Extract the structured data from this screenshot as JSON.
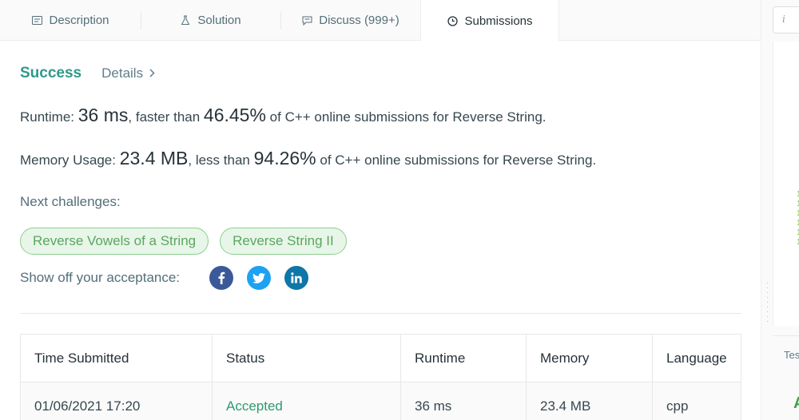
{
  "tabs": [
    {
      "label": "Description",
      "icon": "description-icon"
    },
    {
      "label": "Solution",
      "icon": "flask-icon"
    },
    {
      "label": "Discuss (999+)",
      "icon": "discuss-icon"
    },
    {
      "label": "Submissions",
      "icon": "clock-icon"
    }
  ],
  "right_panel": {
    "input_glyph": "i",
    "tab_label": "Tes",
    "status_letter": "A"
  },
  "result": {
    "status": "Success",
    "details_label": "Details",
    "status_color": "#2e9a8c"
  },
  "runtime": {
    "label": "Runtime:",
    "value": "36 ms",
    "middle": ", faster than",
    "percent": "46.45%",
    "suffix": "of C++ online submissions for Reverse String."
  },
  "memory": {
    "label": "Memory Usage:",
    "value": "23.4 MB",
    "middle": ", less than",
    "percent": "94.26%",
    "suffix": "of C++ online submissions for Reverse String."
  },
  "next_challenges": {
    "label": "Next challenges:",
    "items": [
      "Reverse Vowels of a String",
      "Reverse String II"
    ]
  },
  "share": {
    "label": "Show off your acceptance:",
    "networks": [
      "facebook-icon",
      "twitter-icon",
      "linkedin-icon"
    ]
  },
  "table": {
    "headers": [
      "Time Submitted",
      "Status",
      "Runtime",
      "Memory",
      "Language"
    ],
    "rows": [
      [
        "01/06/2021 17:20",
        "Accepted",
        "36 ms",
        "23.4 MB",
        "cpp"
      ]
    ]
  }
}
